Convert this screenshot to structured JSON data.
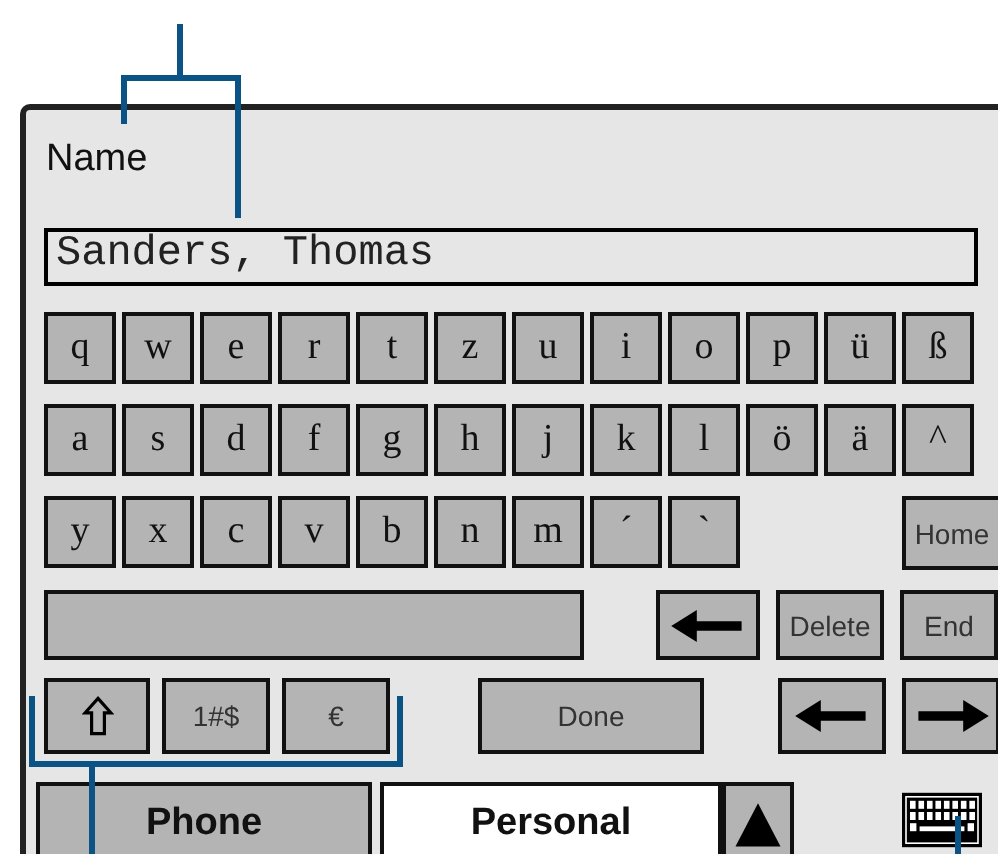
{
  "field": {
    "label": "Name",
    "value": "Sanders, Thomas"
  },
  "key_rows": [
    [
      {
        "kind": "char",
        "label": "q"
      },
      {
        "kind": "char",
        "label": "w"
      },
      {
        "kind": "char",
        "label": "e"
      },
      {
        "kind": "char",
        "label": "r"
      },
      {
        "kind": "char",
        "label": "t"
      },
      {
        "kind": "char",
        "label": "z"
      },
      {
        "kind": "char",
        "label": "u"
      },
      {
        "kind": "char",
        "label": "i"
      },
      {
        "kind": "char",
        "label": "o"
      },
      {
        "kind": "char",
        "label": "p"
      },
      {
        "kind": "char",
        "label": "ü"
      },
      {
        "kind": "char",
        "label": "ß"
      }
    ],
    [
      {
        "kind": "char",
        "label": "a"
      },
      {
        "kind": "char",
        "label": "s"
      },
      {
        "kind": "char",
        "label": "d"
      },
      {
        "kind": "char",
        "label": "f"
      },
      {
        "kind": "char",
        "label": "g"
      },
      {
        "kind": "char",
        "label": "h"
      },
      {
        "kind": "char",
        "label": "j"
      },
      {
        "kind": "char",
        "label": "k"
      },
      {
        "kind": "char",
        "label": "l"
      },
      {
        "kind": "char",
        "label": "ö"
      },
      {
        "kind": "char",
        "label": "ä"
      },
      {
        "kind": "char",
        "label": "^"
      }
    ],
    [
      {
        "kind": "char",
        "label": "y"
      },
      {
        "kind": "char",
        "label": "x"
      },
      {
        "kind": "char",
        "label": "c"
      },
      {
        "kind": "char",
        "label": "v"
      },
      {
        "kind": "char",
        "label": "b"
      },
      {
        "kind": "char",
        "label": "n"
      },
      {
        "kind": "char",
        "label": "m"
      },
      {
        "kind": "char",
        "label": "´"
      },
      {
        "kind": "char",
        "label": "`"
      },
      {
        "kind": "text",
        "label": "Home"
      }
    ],
    [
      {
        "kind": "space"
      },
      {
        "kind": "backspace"
      },
      {
        "kind": "text",
        "label": "Delete"
      },
      {
        "kind": "text",
        "label": "End"
      }
    ],
    [
      {
        "kind": "shift"
      },
      {
        "kind": "text",
        "label": "1#$"
      },
      {
        "kind": "text",
        "label": "€"
      },
      {
        "kind": "text",
        "label": "Done"
      },
      {
        "kind": "left"
      },
      {
        "kind": "right"
      }
    ]
  ],
  "tabs": [
    {
      "label": "Phone",
      "selected": false
    },
    {
      "label": "Personal",
      "selected": true
    }
  ]
}
